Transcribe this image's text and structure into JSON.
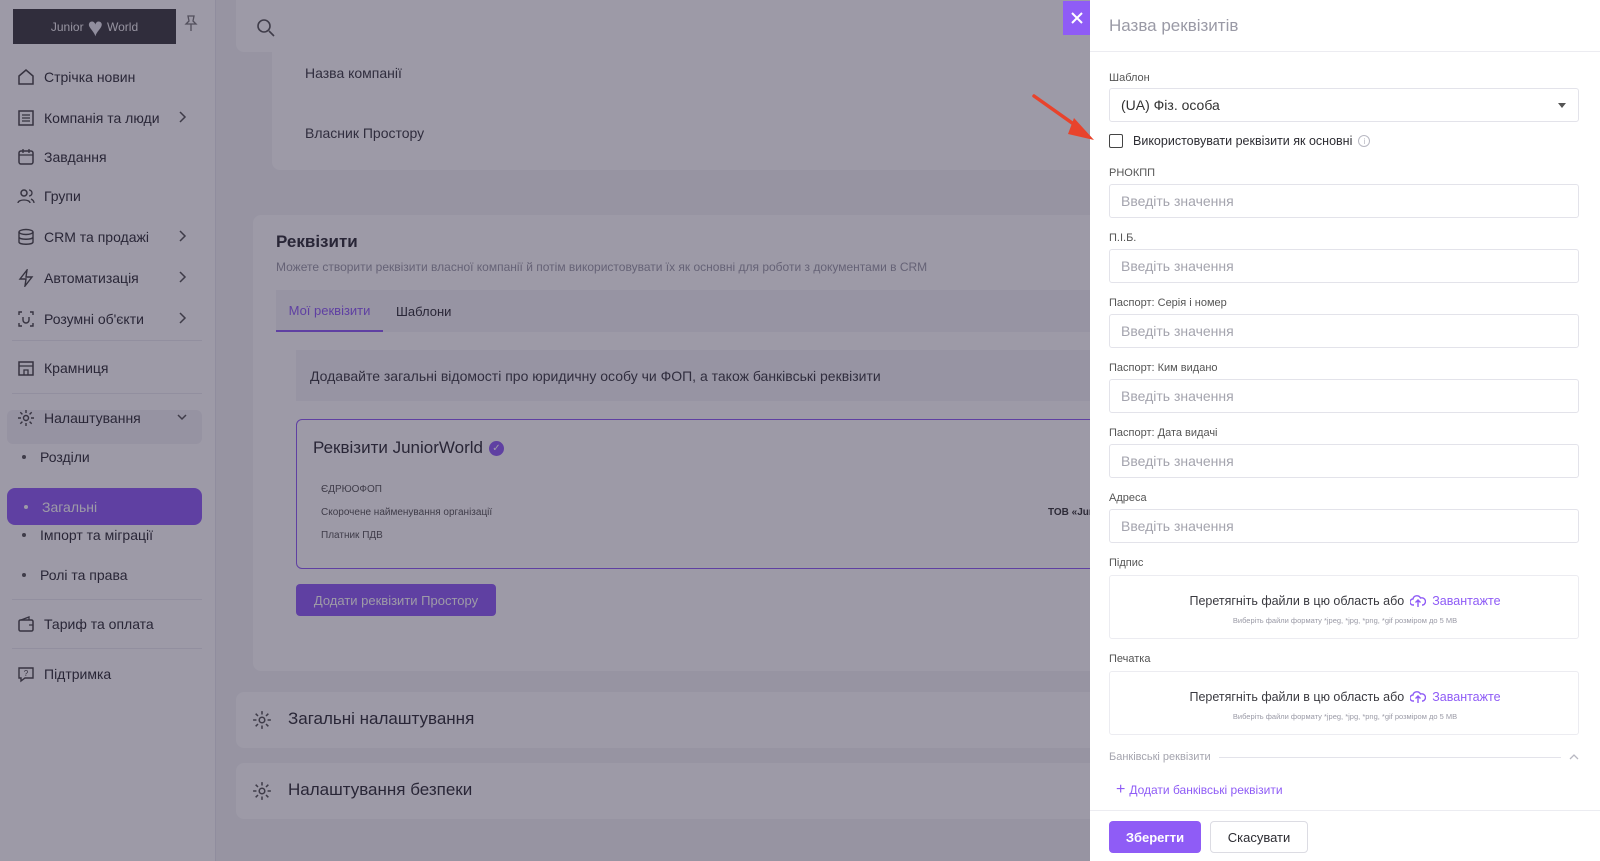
{
  "sidebar": {
    "logo_left": "Junior",
    "logo_right": "World",
    "items": [
      {
        "label": "Стрічка новин",
        "icon": "home-icon"
      },
      {
        "label": "Компанія та люди",
        "icon": "building-icon"
      },
      {
        "label": "Завдання",
        "icon": "calendar-icon"
      },
      {
        "label": "Групи",
        "icon": "users-icon"
      },
      {
        "label": "CRM та продажі",
        "icon": "database-icon"
      },
      {
        "label": "Автоматизація",
        "icon": "lightning-icon"
      },
      {
        "label": "Розумні об'єкти",
        "icon": "smart-object-icon"
      },
      {
        "label": "Крамниця",
        "icon": "store-icon"
      },
      {
        "label": "Налаштування",
        "icon": "gear-icon"
      },
      {
        "label": "Тариф та оплата",
        "icon": "wallet-icon"
      },
      {
        "label": "Підтримка",
        "icon": "support-icon"
      }
    ],
    "settings_sub": [
      "Розділи",
      "Загальні",
      "Імпорт та міграції",
      "Ролі та права"
    ]
  },
  "main": {
    "company_name_label": "Назва компанії",
    "owner_label": "Власник Простору",
    "requisites": {
      "title": "Реквізити",
      "description": "Можете створити реквізити власної компанії й потім використовувати їх як основні для роботи з документами в CRM",
      "tabs": [
        "Мої реквізити",
        "Шаблони"
      ],
      "info": "Додавайте загальні відомості про юридичну особу чи ФОП, а також банківські реквізити",
      "card_title": "Реквізити JuniorWorld",
      "rows": [
        {
          "label": "ЄДРЮОФОП",
          "value": ""
        },
        {
          "label": "Скорочене найменування організації",
          "value": "ТОВ «Jun"
        },
        {
          "label": "Платник ПДВ",
          "value": ""
        }
      ],
      "add_button": "Додати реквізити Простору"
    },
    "general_settings": "Загальні налаштування",
    "security_settings": "Налаштування безпеки"
  },
  "drawer": {
    "title": "Назва реквізитів",
    "template_label": "Шаблон",
    "template_value": "(UA) Фіз. особа",
    "use_as_main": "Використовувати реквізити як основні",
    "fields": [
      {
        "label": "РНОКПП",
        "placeholder": "Введіть значення"
      },
      {
        "label": "П.І.Б.",
        "placeholder": "Введіть значення"
      },
      {
        "label": "Паспорт: Серія і номер",
        "placeholder": "Введіть значення"
      },
      {
        "label": "Паспорт: Ким видано",
        "placeholder": "Введіть значення"
      },
      {
        "label": "Паспорт: Дата видачі",
        "placeholder": "Введіть значення"
      },
      {
        "label": "Адреса",
        "placeholder": "Введіть значення"
      }
    ],
    "signature_label": "Підпис",
    "stamp_label": "Печатка",
    "upload_text": "Перетягніть файли в цю область або",
    "upload_link": "Завантажте",
    "upload_hint": "Виберіть файли формату *jpeg, *jpg, *png, *gif розміром до 5 MB",
    "bank_section": "Банківські реквізити",
    "add_bank": "Додати банківські реквізити",
    "save": "Зберегти",
    "cancel": "Скасувати"
  },
  "colors": {
    "accent": "#8f5cf6",
    "annotation_arrow": "#e8432c"
  }
}
